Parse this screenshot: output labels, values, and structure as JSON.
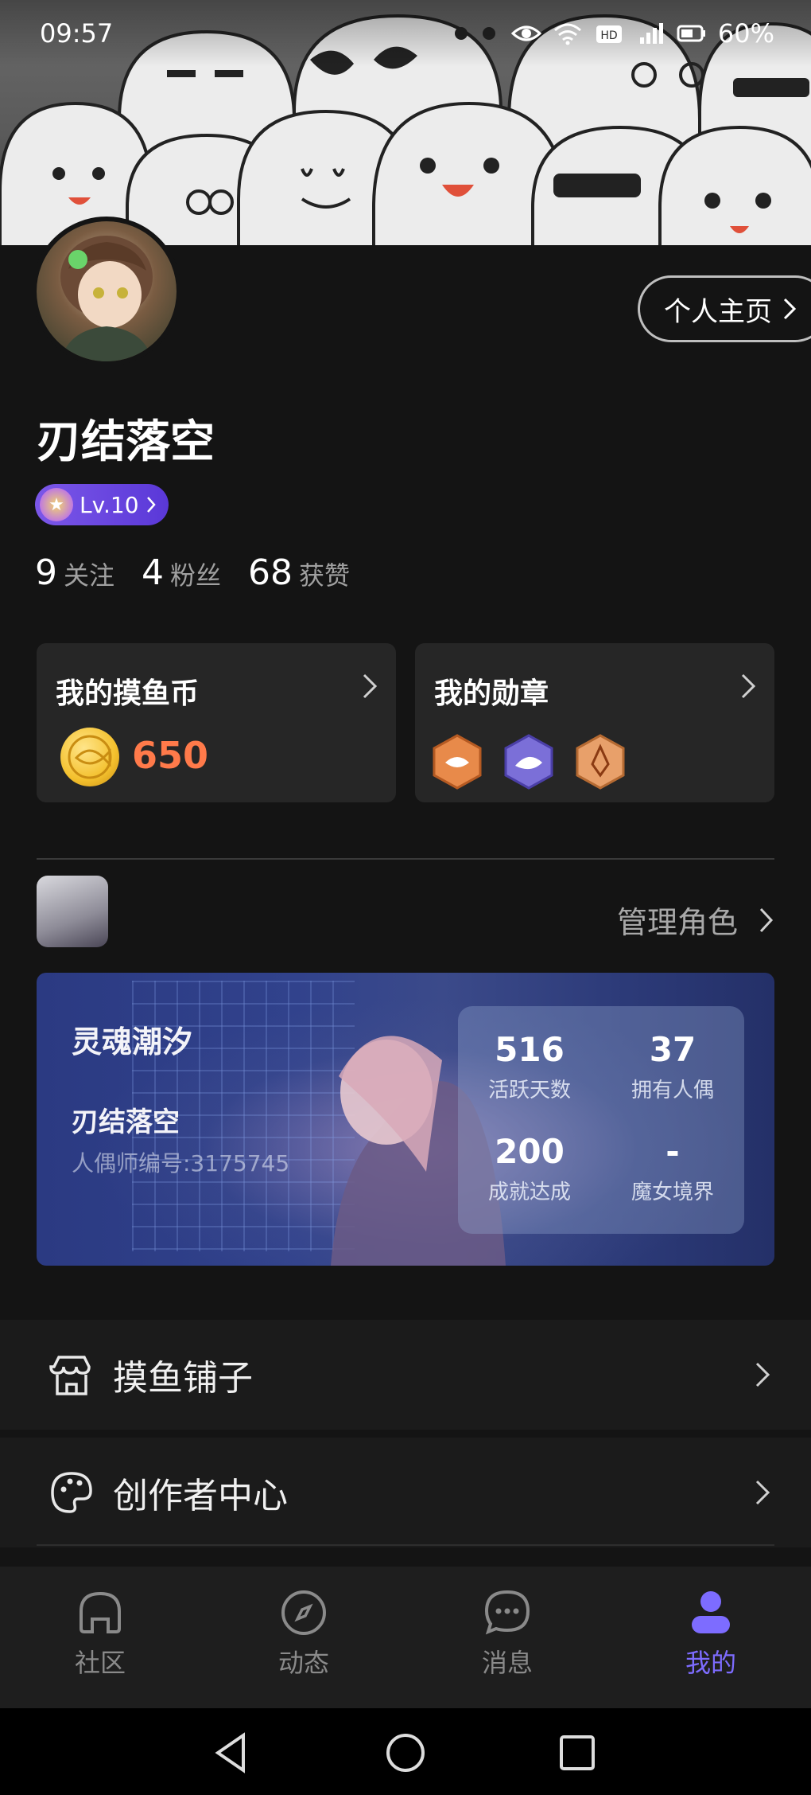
{
  "status_bar": {
    "time": "09:57",
    "battery": "60%",
    "icons": [
      "eye-icon",
      "wifi-icon",
      "hd-icon",
      "signal-4g-icon",
      "battery-icon"
    ]
  },
  "header": {
    "profile_button": "个人主页"
  },
  "user": {
    "name": "刃结落空",
    "level": "Lv.10",
    "stats": [
      {
        "value": "9",
        "label": "关注"
      },
      {
        "value": "4",
        "label": "粉丝"
      },
      {
        "value": "68",
        "label": "获赞"
      }
    ]
  },
  "cards": {
    "coins": {
      "title": "我的摸鱼币",
      "value": "650"
    },
    "medals": {
      "title": "我的勋章",
      "icons": [
        "fish-medal-icon",
        "shark-medal-icon",
        "pen-medal-icon"
      ]
    }
  },
  "role": {
    "manage_label": "管理角色",
    "server": "灵魂潮汐",
    "name": "刃结落空",
    "id_text": "人偶师编号:3175745",
    "stats": [
      {
        "value": "516",
        "label": "活跃天数"
      },
      {
        "value": "37",
        "label": "拥有人偶"
      },
      {
        "value": "200",
        "label": "成就达成"
      },
      {
        "value": "-",
        "label": "魔女境界"
      }
    ]
  },
  "menu": [
    {
      "label": "摸鱼铺子",
      "icon": "shop-icon"
    },
    {
      "label": "创作者中心",
      "icon": "palette-icon"
    }
  ],
  "bottom_nav": [
    {
      "label": "社区",
      "icon": "home-icon"
    },
    {
      "label": "动态",
      "icon": "compass-icon"
    },
    {
      "label": "消息",
      "icon": "chat-icon"
    },
    {
      "label": "我的",
      "icon": "user-icon",
      "active": true
    }
  ],
  "colors": {
    "accent": "#7d6cff",
    "coin_value": "#ff7a4a",
    "background": "#141414"
  }
}
